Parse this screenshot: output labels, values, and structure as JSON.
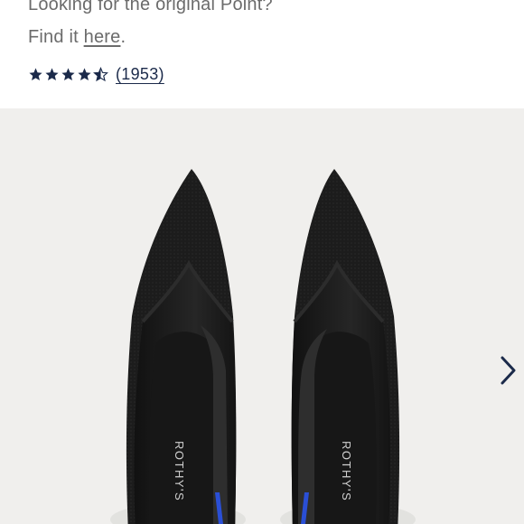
{
  "promo": {
    "line1": "Looking for the original Point?",
    "line2_prefix": "Find it ",
    "line2_link": "here",
    "line2_suffix": "."
  },
  "rating": {
    "stars": 4.5,
    "max_stars": 5,
    "review_count": "(1953)",
    "color": "#1b2a4a"
  },
  "gallery": {
    "brand_label_left": "ROTHY'S",
    "brand_label_right": "ROTHY'S",
    "next_icon": "chevron-right-icon",
    "background": "#f0efed",
    "shoe_color": "#1c1c1c",
    "accent_color": "#2a4fd6"
  }
}
